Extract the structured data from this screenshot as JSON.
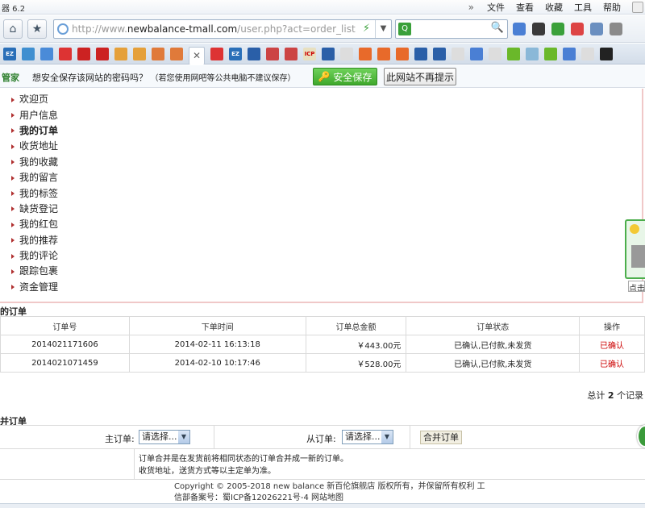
{
  "browser": {
    "version": "器 6.2",
    "menu": [
      "文件",
      "查看",
      "收藏",
      "工具",
      "帮助"
    ],
    "url_prefix": "http://www.",
    "url_host": "newbalance-tmall.com",
    "url_path": "/user.php?act=order_list",
    "search_value": ""
  },
  "tabs": [
    "EZ",
    "",
    "",
    "",
    "",
    "",
    "",
    "",
    "",
    "",
    "EZ",
    "",
    "",
    "",
    "ICP",
    "",
    "",
    "",
    "",
    "",
    "",
    "",
    "",
    "",
    "",
    "",
    "",
    "",
    "",
    ""
  ],
  "password_bar": {
    "brand": "管家",
    "question": "想安全保存该网站的密码吗？",
    "hint": "（若您使用网吧等公共电脑不建议保存）",
    "save_label": "安全保存",
    "never_label": "此网站不再提示"
  },
  "sidebar": {
    "items": [
      {
        "label": "欢迎页"
      },
      {
        "label": "用户信息"
      },
      {
        "label": "我的订单"
      },
      {
        "label": "收货地址"
      },
      {
        "label": "我的收藏"
      },
      {
        "label": "我的留言"
      },
      {
        "label": "我的标签"
      },
      {
        "label": "缺货登记"
      },
      {
        "label": "我的红包"
      },
      {
        "label": "我的推荐"
      },
      {
        "label": "我的评论"
      },
      {
        "label": "跟踪包裹"
      },
      {
        "label": "资金管理"
      }
    ]
  },
  "widget": {
    "text": "点击"
  },
  "orders": {
    "title": "的订单",
    "headers": [
      "订单号",
      "下单时间",
      "订单总金额",
      "订单状态",
      "操作"
    ],
    "rows": [
      {
        "id": "2014021171606",
        "time": "2014-02-11 16:13:18",
        "amount": "￥443.00元",
        "status": "已确认,已付款,未发货",
        "op": "已确认"
      },
      {
        "id": "2014021071459",
        "time": "2014-02-10 10:17:46",
        "amount": "￥528.00元",
        "status": "已确认,已付款,未发货",
        "op": "已确认"
      }
    ],
    "total_prefix": "总计",
    "total_count": "2",
    "total_suffix": "个记录"
  },
  "merge": {
    "title": "并订单",
    "main_label": "主订单:",
    "from_label": "从订单:",
    "main_select": "请选择...",
    "from_select": "请选择...",
    "button_label": "合并订单",
    "note_line1": "订单合并是在发货前将相同状态的订单合并成一新的订单。",
    "note_line2": "收货地址，送货方式等以主定单为准。"
  },
  "footer": {
    "line1": "Copyright © 2005-2018 new balance 新百伦旗舰店 版权所有，并保留所有权利 工",
    "line2": "信部备案号：蜀ICP备12026221号-4 网站地图"
  }
}
